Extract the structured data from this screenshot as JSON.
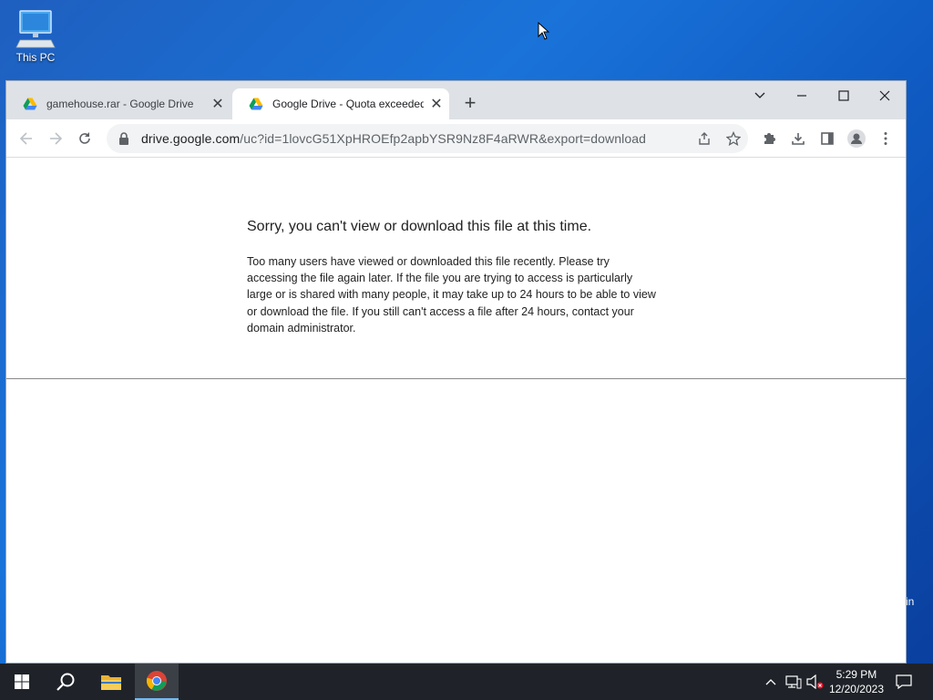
{
  "desktop": {
    "icon_label": "This PC",
    "edge_text": "in"
  },
  "browser": {
    "tabs": [
      {
        "label": "gamehouse.rar - Google Drive",
        "active": false,
        "icon": "google-drive-icon"
      },
      {
        "label": "Google Drive - Quota exceeded",
        "active": true,
        "icon": "google-drive-icon"
      }
    ],
    "address": {
      "host": "drive.google.com",
      "path": "/uc?id=1lovcG51XpHROEfp2apbYSR9Nz8F4aRWR&export=download"
    }
  },
  "page": {
    "heading": "Sorry, you can't view or download this file at this time.",
    "body": "Too many users have viewed or downloaded this file recently. Please try accessing the file again later. If the file you are trying to access is particularly large or is shared with many people, it may take up to 24 hours to be able to view or download the file. If you still can't access a file after 24 hours, contact your domain administrator."
  },
  "taskbar": {
    "time": "5:29 PM",
    "date": "12/20/2023"
  },
  "colors": {
    "accent": "#1a73e8",
    "taskbar": "#1f2329"
  }
}
